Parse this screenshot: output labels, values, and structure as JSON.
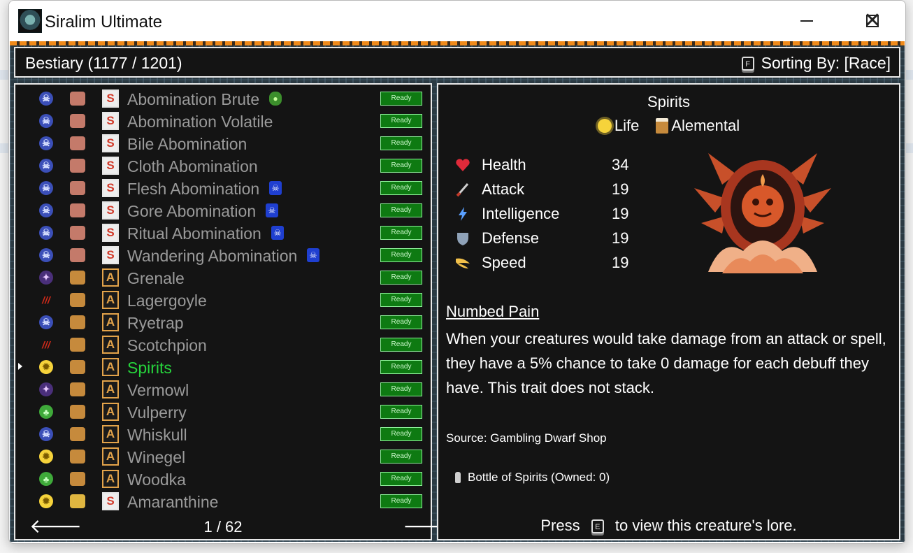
{
  "window": {
    "title": "Siralim Ultimate",
    "controls": {
      "minimize": "minimize",
      "maximize": "maximize",
      "close": "close"
    }
  },
  "header": {
    "title": "Bestiary (1177 / 1201)",
    "sort_key": "F",
    "sort_label": "Sorting By: [Race]"
  },
  "list": {
    "page": "1 / 62",
    "ready_label": "Ready",
    "items": [
      {
        "name": "Abomination Brute",
        "class": "death",
        "race": "abomination",
        "rarity": "S",
        "badge": "green",
        "selected": false
      },
      {
        "name": "Abomination Volatile",
        "class": "death",
        "race": "abomination",
        "rarity": "S",
        "badge": "",
        "selected": false
      },
      {
        "name": "Bile Abomination",
        "class": "death",
        "race": "abomination",
        "rarity": "S",
        "badge": "",
        "selected": false
      },
      {
        "name": "Cloth Abomination",
        "class": "death",
        "race": "abomination",
        "rarity": "S",
        "badge": "",
        "selected": false
      },
      {
        "name": "Flesh Abomination",
        "class": "death",
        "race": "abomination",
        "rarity": "S",
        "badge": "blue",
        "selected": false
      },
      {
        "name": "Gore Abomination",
        "class": "death",
        "race": "abomination",
        "rarity": "S",
        "badge": "blue",
        "selected": false
      },
      {
        "name": "Ritual Abomination",
        "class": "death",
        "race": "abomination",
        "rarity": "S",
        "badge": "blue",
        "selected": false
      },
      {
        "name": "Wandering Abomination",
        "class": "death",
        "race": "abomination",
        "rarity": "S",
        "badge": "blue",
        "selected": false
      },
      {
        "name": "Grenale",
        "class": "sorcery",
        "race": "alemental",
        "rarity": "A",
        "badge": "",
        "selected": false
      },
      {
        "name": "Lagergoyle",
        "class": "chaos",
        "race": "alemental",
        "rarity": "A",
        "badge": "",
        "selected": false
      },
      {
        "name": "Ryetrap",
        "class": "death",
        "race": "alemental",
        "rarity": "A",
        "badge": "",
        "selected": false
      },
      {
        "name": "Scotchpion",
        "class": "chaos",
        "race": "alemental",
        "rarity": "A",
        "badge": "",
        "selected": false
      },
      {
        "name": "Spirits",
        "class": "life",
        "race": "alemental",
        "rarity": "A",
        "badge": "",
        "selected": true
      },
      {
        "name": "Vermowl",
        "class": "sorcery",
        "race": "alemental",
        "rarity": "A",
        "badge": "",
        "selected": false
      },
      {
        "name": "Vulperry",
        "class": "nature",
        "race": "alemental",
        "rarity": "A",
        "badge": "",
        "selected": false
      },
      {
        "name": "Whiskull",
        "class": "death",
        "race": "alemental",
        "rarity": "A",
        "badge": "",
        "selected": false
      },
      {
        "name": "Winegel",
        "class": "life",
        "race": "alemental",
        "rarity": "A",
        "badge": "",
        "selected": false
      },
      {
        "name": "Woodka",
        "class": "nature",
        "race": "alemental",
        "rarity": "A",
        "badge": "",
        "selected": false
      },
      {
        "name": "Amaranthine",
        "class": "life",
        "race": "amaranthine",
        "rarity": "S",
        "badge": "",
        "selected": false
      }
    ]
  },
  "detail": {
    "name": "Spirits",
    "class_label": "Life",
    "race_label": "Alemental",
    "stats": [
      {
        "label": "Health",
        "value": "34",
        "icon": "heart-icon"
      },
      {
        "label": "Attack",
        "value": "19",
        "icon": "sword-icon"
      },
      {
        "label": "Intelligence",
        "value": "19",
        "icon": "lightning-icon"
      },
      {
        "label": "Defense",
        "value": "19",
        "icon": "shield-icon"
      },
      {
        "label": "Speed",
        "value": "19",
        "icon": "wing-icon"
      }
    ],
    "trait_name": "Numbed Pain",
    "trait_description": "When your creatures would take damage from an attack or spell, they have a 5% chance to take 0 damage for each debuff they have. This trait does not stack.",
    "source": "Source: Gambling Dwarf Shop",
    "item": "Bottle of Spirits (Owned: 0)",
    "press_before": "Press",
    "press_key": "E",
    "press_after": "to view this creature's lore."
  },
  "colors": {
    "selected_name": "#26d43c",
    "unselected_name": "#9a9a9a",
    "ready_bg": "#0e7a12",
    "panel_bg": "#141414"
  }
}
